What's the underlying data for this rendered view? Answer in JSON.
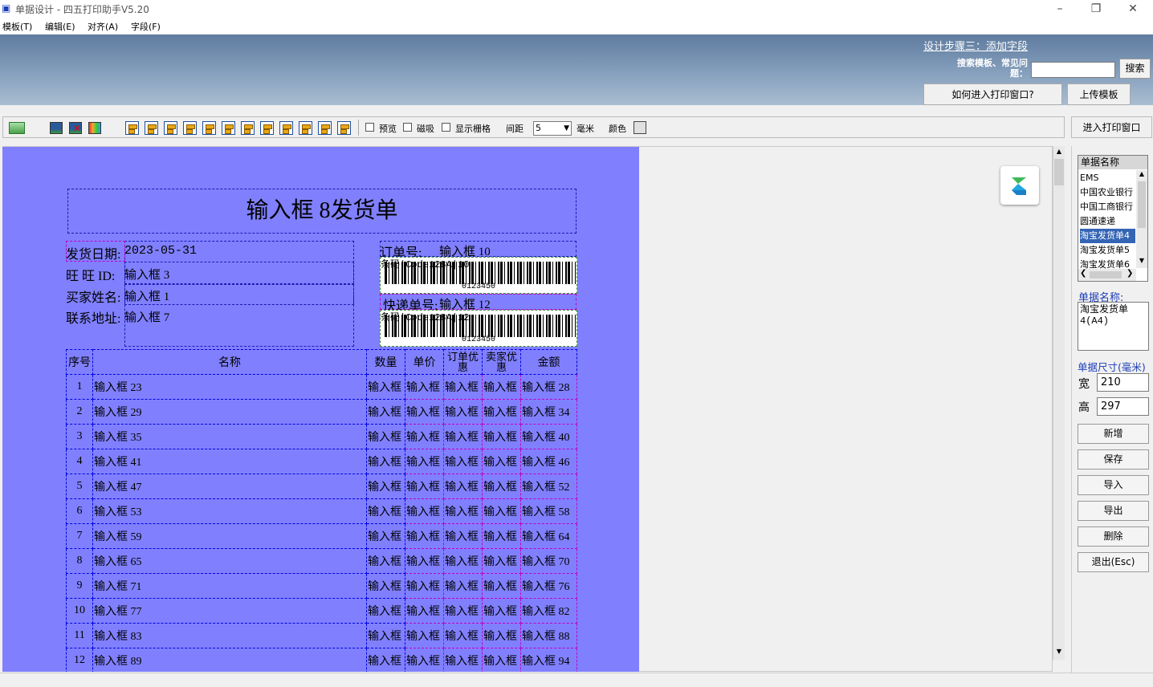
{
  "window": {
    "title": "单据设计 - 四五打印助手V5.20",
    "icon": "app-logo-icon"
  },
  "menu": [
    "模板(T)",
    "编辑(E)",
    "对齐(A)",
    "字段(F)"
  ],
  "header": {
    "step_link": "设计步骤三：添加字段",
    "search_label": "搜索模板、常见问题：",
    "search_button": "搜索",
    "how_print_button": "如何进入打印窗口?",
    "upload_button": "上传模板"
  },
  "toolbar": {
    "preview": "预览",
    "snap": "磁吸",
    "show_grid": "显示栅格",
    "spacing_label": "间距",
    "spacing_value": "5",
    "unit": "毫米",
    "color_label": "颜色",
    "color_value": "#e0e0e0"
  },
  "enter_print_button": "进入打印窗口",
  "doc": {
    "title": "输入框 8发货单",
    "ship_date_label": "发货日期:",
    "ship_date": "2023-05-31",
    "wangwang_label": "旺 旺 ID:",
    "wangwang_value": "输入框 3",
    "buyer_label": "买家姓名:",
    "buyer_value": "输入框 1",
    "address_label": "联系地址:",
    "address_value": "输入框 7",
    "order_label": "订单号:",
    "order_value": "输入框 10",
    "barcode1_label": "条码|Code128A|10",
    "barcode1_num": "0123450",
    "express_label": "快递单号:",
    "express_value": "输入框 12",
    "barcode2_label": "条码|Code128A|12",
    "barcode2_num": "0123450",
    "columns": [
      "序号",
      "名称",
      "数量",
      "单价",
      "订单优惠",
      "卖家优惠",
      "金额"
    ],
    "rows": [
      {
        "no": "1",
        "name": "输入框 23",
        "qty": "输入框",
        "price": "输入框",
        "od": "输入框",
        "sd": "输入框",
        "amt": "输入框 28"
      },
      {
        "no": "2",
        "name": "输入框 29",
        "qty": "输入框",
        "price": "输入框",
        "od": "输入框",
        "sd": "输入框",
        "amt": "输入框 34"
      },
      {
        "no": "3",
        "name": "输入框 35",
        "qty": "输入框",
        "price": "输入框",
        "od": "输入框",
        "sd": "输入框",
        "amt": "输入框 40"
      },
      {
        "no": "4",
        "name": "输入框 41",
        "qty": "输入框",
        "price": "输入框",
        "od": "输入框",
        "sd": "输入框",
        "amt": "输入框 46"
      },
      {
        "no": "5",
        "name": "输入框 47",
        "qty": "输入框",
        "price": "输入框",
        "od": "输入框",
        "sd": "输入框",
        "amt": "输入框 52"
      },
      {
        "no": "6",
        "name": "输入框 53",
        "qty": "输入框",
        "price": "输入框",
        "od": "输入框",
        "sd": "输入框",
        "amt": "输入框 58"
      },
      {
        "no": "7",
        "name": "输入框 59",
        "qty": "输入框",
        "price": "输入框",
        "od": "输入框",
        "sd": "输入框",
        "amt": "输入框 64"
      },
      {
        "no": "8",
        "name": "输入框 65",
        "qty": "输入框",
        "price": "输入框",
        "od": "输入框",
        "sd": "输入框",
        "amt": "输入框 70"
      },
      {
        "no": "9",
        "name": "输入框 71",
        "qty": "输入框",
        "price": "输入框",
        "od": "输入框",
        "sd": "输入框",
        "amt": "输入框 76"
      },
      {
        "no": "10",
        "name": "输入框 77",
        "qty": "输入框",
        "price": "输入框",
        "od": "输入框",
        "sd": "输入框",
        "amt": "输入框 82"
      },
      {
        "no": "11",
        "name": "输入框 83",
        "qty": "输入框",
        "price": "输入框",
        "od": "输入框",
        "sd": "输入框",
        "amt": "输入框 88"
      },
      {
        "no": "12",
        "name": "输入框 89",
        "qty": "输入框",
        "price": "输入框",
        "od": "输入框",
        "sd": "输入框",
        "amt": "输入框 94"
      }
    ]
  },
  "panel": {
    "list_header": "单据名称",
    "templates": [
      "EMS",
      "中国农业银行",
      "中国工商银行",
      "圆通速递",
      "淘宝发货单4",
      "淘宝发货单5",
      "淘宝发货单6"
    ],
    "selected_template": "淘宝发货单4",
    "name_label": "单据名称:",
    "name_value": "淘宝发货单4(A4)",
    "size_label": "单据尺寸(毫米)",
    "width_label": "宽",
    "width_value": "210",
    "height_label": "高",
    "height_value": "297",
    "buttons": [
      "新增",
      "保存",
      "导入",
      "导出",
      "删除",
      "退出(Esc)"
    ]
  }
}
